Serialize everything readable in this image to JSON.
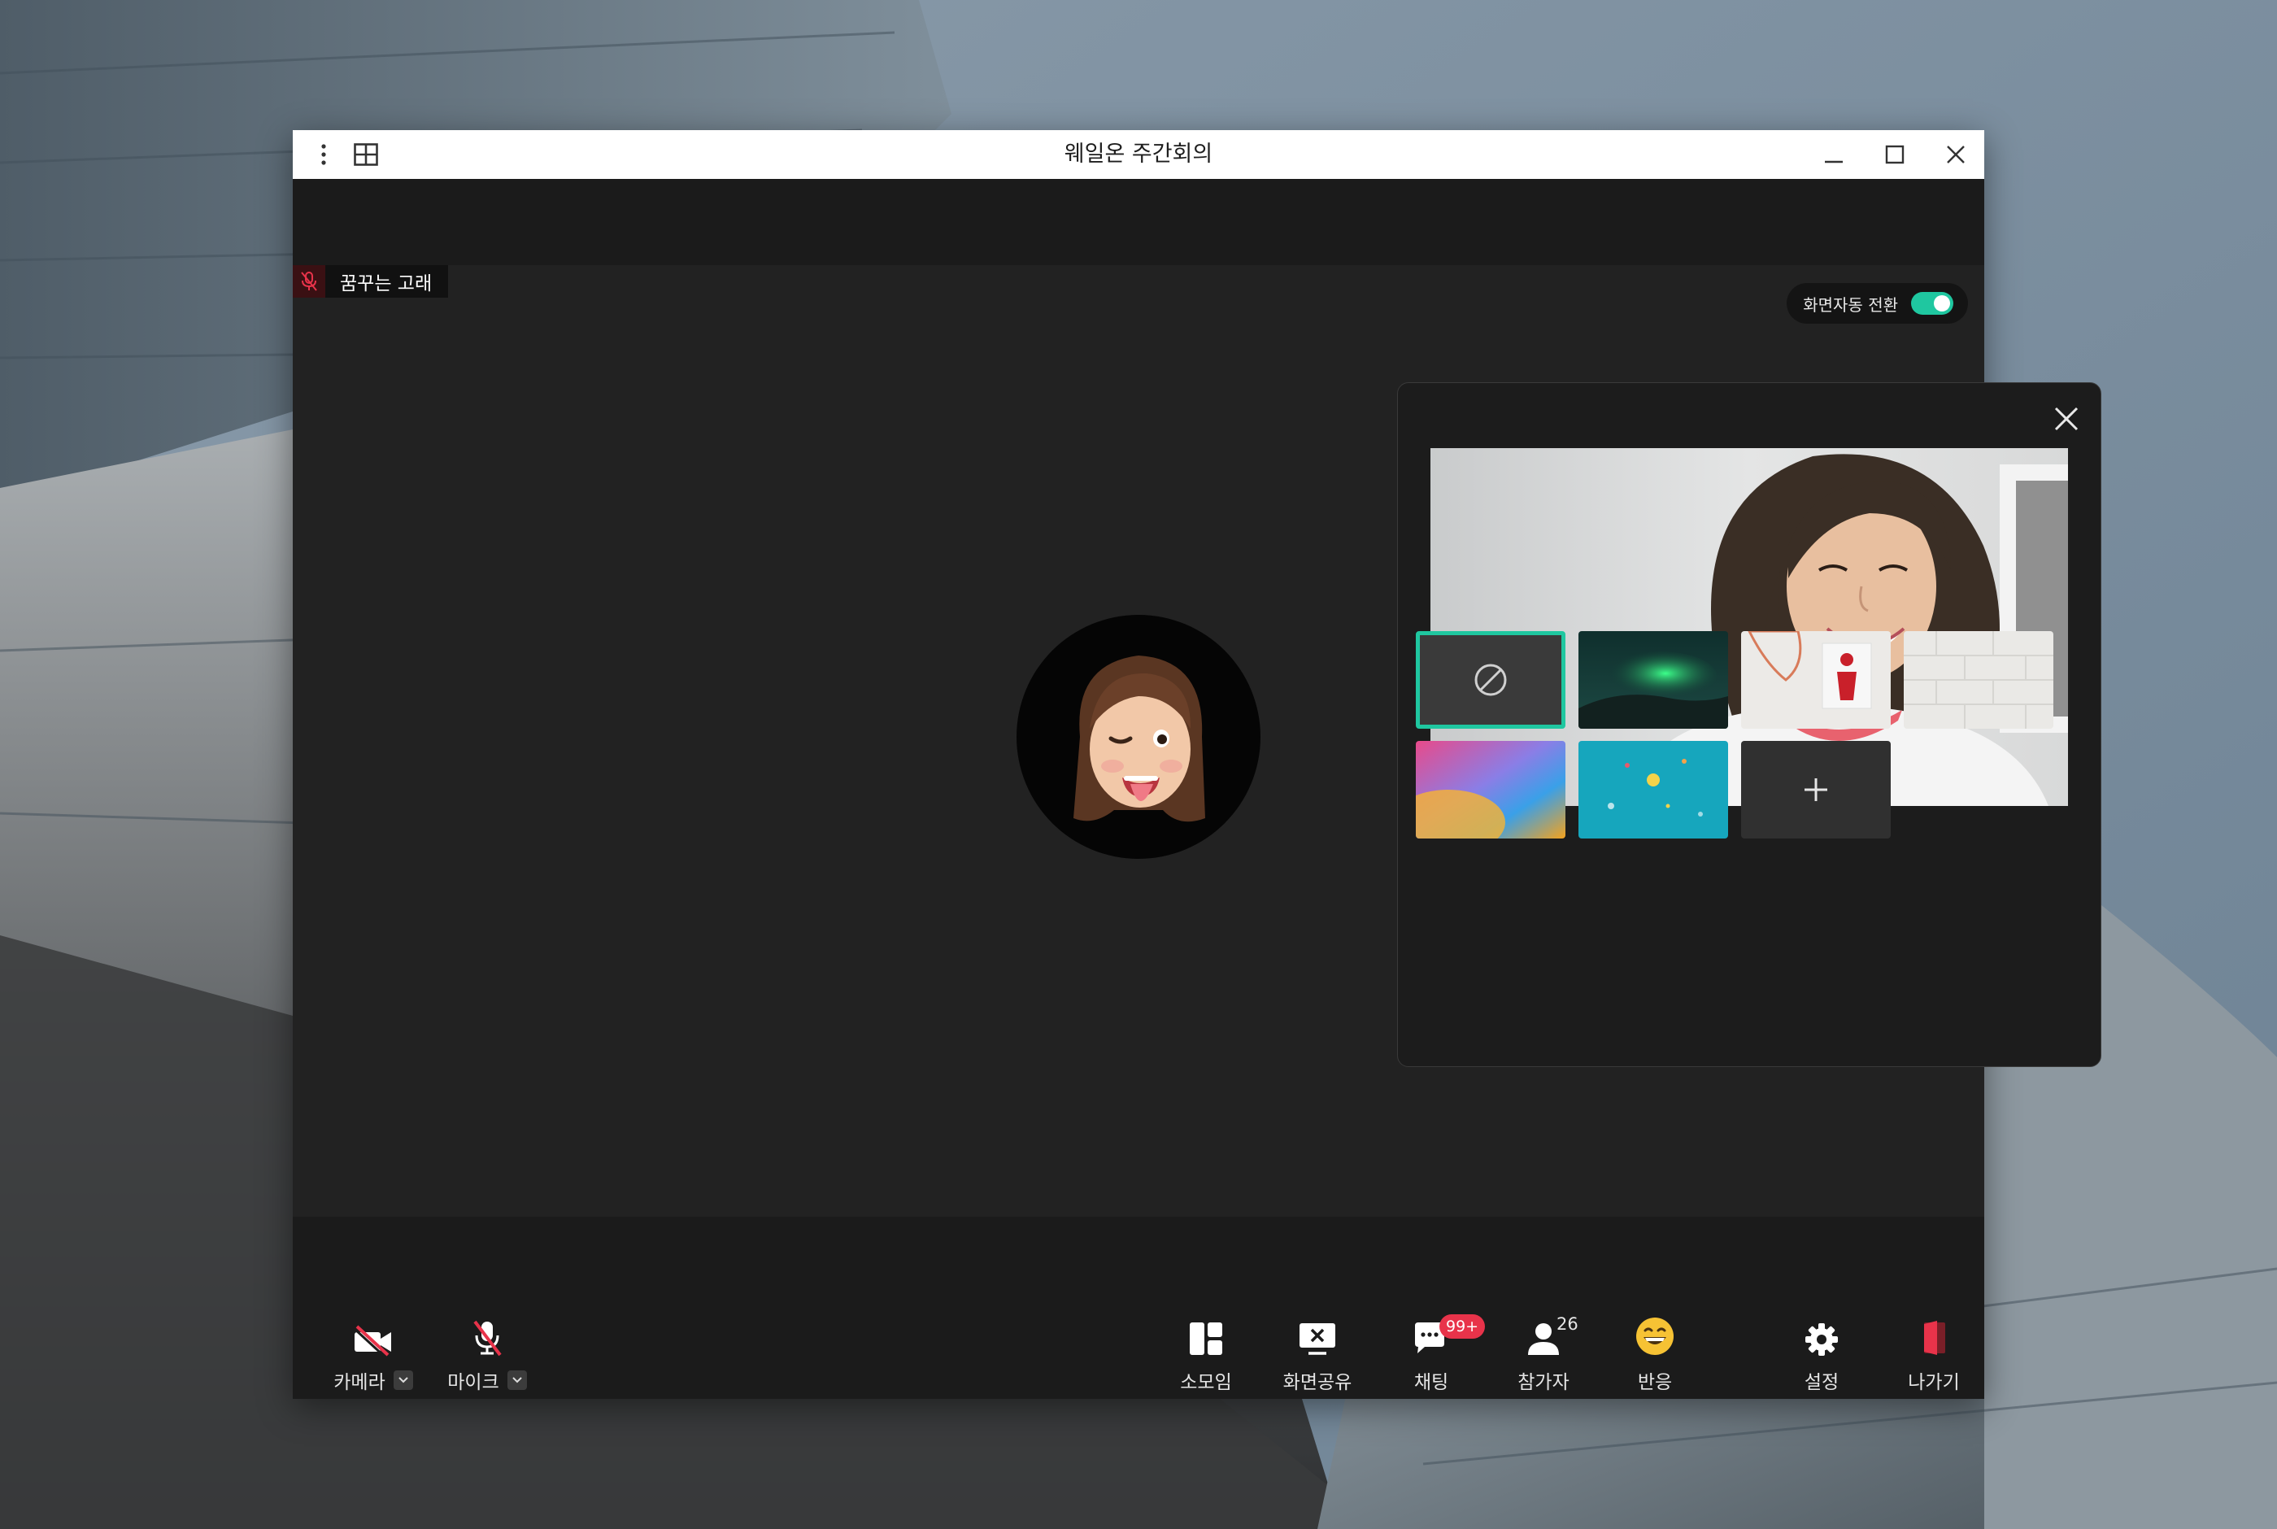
{
  "window": {
    "title": "웨일온 주간회의"
  },
  "titlebar": {
    "menu_icon": "more-vertical-icon",
    "layout_icon": "grid-layout-icon",
    "minimize_icon": "minimize-icon",
    "maximize_icon": "maximize-icon",
    "close_icon": "close-icon"
  },
  "stage": {
    "speaker_name": "꿈꾸는 고래",
    "auto_switch_label": "화면자동 전환",
    "auto_switch_on": true
  },
  "background_panel": {
    "selected_index": 0,
    "thumbnails": [
      "none",
      "aurora",
      "red-figure-wall",
      "white-brick",
      "gradient",
      "teal-confetti",
      "add"
    ]
  },
  "toolbar": {
    "camera_label": "카메라",
    "mic_label": "마이크",
    "breakout_label": "소모임",
    "share_label": "화면공유",
    "chat_label": "채팅",
    "chat_badge": "99+",
    "participants_label": "참가자",
    "participants_count": "26",
    "reaction_label": "반응",
    "settings_label": "설정",
    "leave_label": "나가기"
  },
  "colors": {
    "accent": "#1fc7a0",
    "badge": "#e8334a",
    "leave": "#e8334a"
  }
}
